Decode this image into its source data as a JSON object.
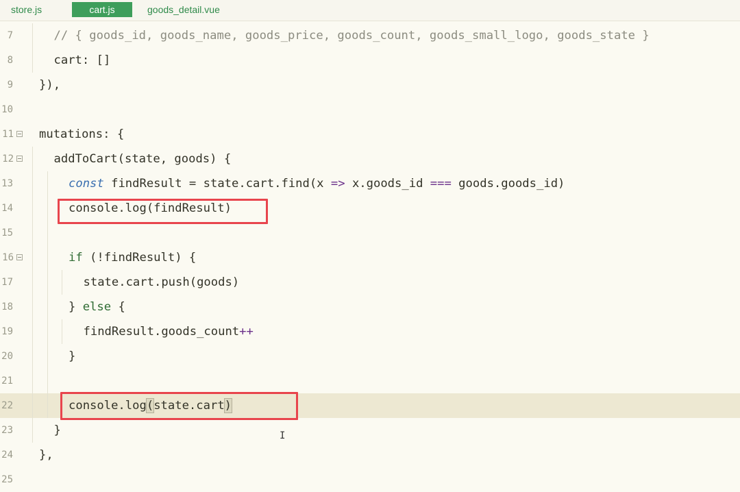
{
  "tabs": [
    {
      "label": "store.js",
      "active": false
    },
    {
      "label": "cart.js",
      "active": true
    },
    {
      "label": "goods_detail.vue",
      "active": false
    }
  ],
  "lines": [
    {
      "num": "7",
      "fold": false,
      "indent": 1,
      "text": "// { goods_id, goods_name, goods_price, goods_count, goods_small_logo, goods_state }",
      "kind": "comment"
    },
    {
      "num": "8",
      "fold": false,
      "indent": 1,
      "text": "cart: []"
    },
    {
      "num": "9",
      "fold": false,
      "indent": 0,
      "text": "}),"
    },
    {
      "num": "10",
      "fold": false,
      "indent": 0,
      "text": ""
    },
    {
      "num": "11",
      "fold": true,
      "indent": 0,
      "text": "mutations: {"
    },
    {
      "num": "12",
      "fold": true,
      "indent": 1,
      "text": "addToCart(state, goods) {"
    },
    {
      "num": "13",
      "fold": false,
      "indent": 2,
      "text": "const findResult = state.cart.find(x => x.goods_id === goods.goods_id)"
    },
    {
      "num": "14",
      "fold": false,
      "indent": 2,
      "text": "console.log(findResult)"
    },
    {
      "num": "15",
      "fold": false,
      "indent": 2,
      "text": ""
    },
    {
      "num": "16",
      "fold": true,
      "indent": 2,
      "text": "if (!findResult) {"
    },
    {
      "num": "17",
      "fold": false,
      "indent": 3,
      "text": "state.cart.push(goods)"
    },
    {
      "num": "18",
      "fold": false,
      "indent": 2,
      "text": "} else {"
    },
    {
      "num": "19",
      "fold": false,
      "indent": 3,
      "text": "findResult.goods_count++"
    },
    {
      "num": "20",
      "fold": false,
      "indent": 2,
      "text": "}"
    },
    {
      "num": "21",
      "fold": false,
      "indent": 2,
      "text": ""
    },
    {
      "num": "22",
      "fold": false,
      "indent": 2,
      "text": "console.log(state.cart)",
      "current": true
    },
    {
      "num": "23",
      "fold": false,
      "indent": 1,
      "text": "}"
    },
    {
      "num": "24",
      "fold": false,
      "indent": 0,
      "text": "},"
    },
    {
      "num": "25",
      "fold": false,
      "indent": 0,
      "text": ""
    }
  ],
  "highlights": [
    {
      "line": "14",
      "label": "console.log(findResult)"
    },
    {
      "line": "22",
      "label": "console.log(state.cart)"
    }
  ],
  "colors": {
    "active_tab": "#3e9e5b",
    "highlight_box": "#e8454d",
    "current_line": "#ede8d2"
  }
}
